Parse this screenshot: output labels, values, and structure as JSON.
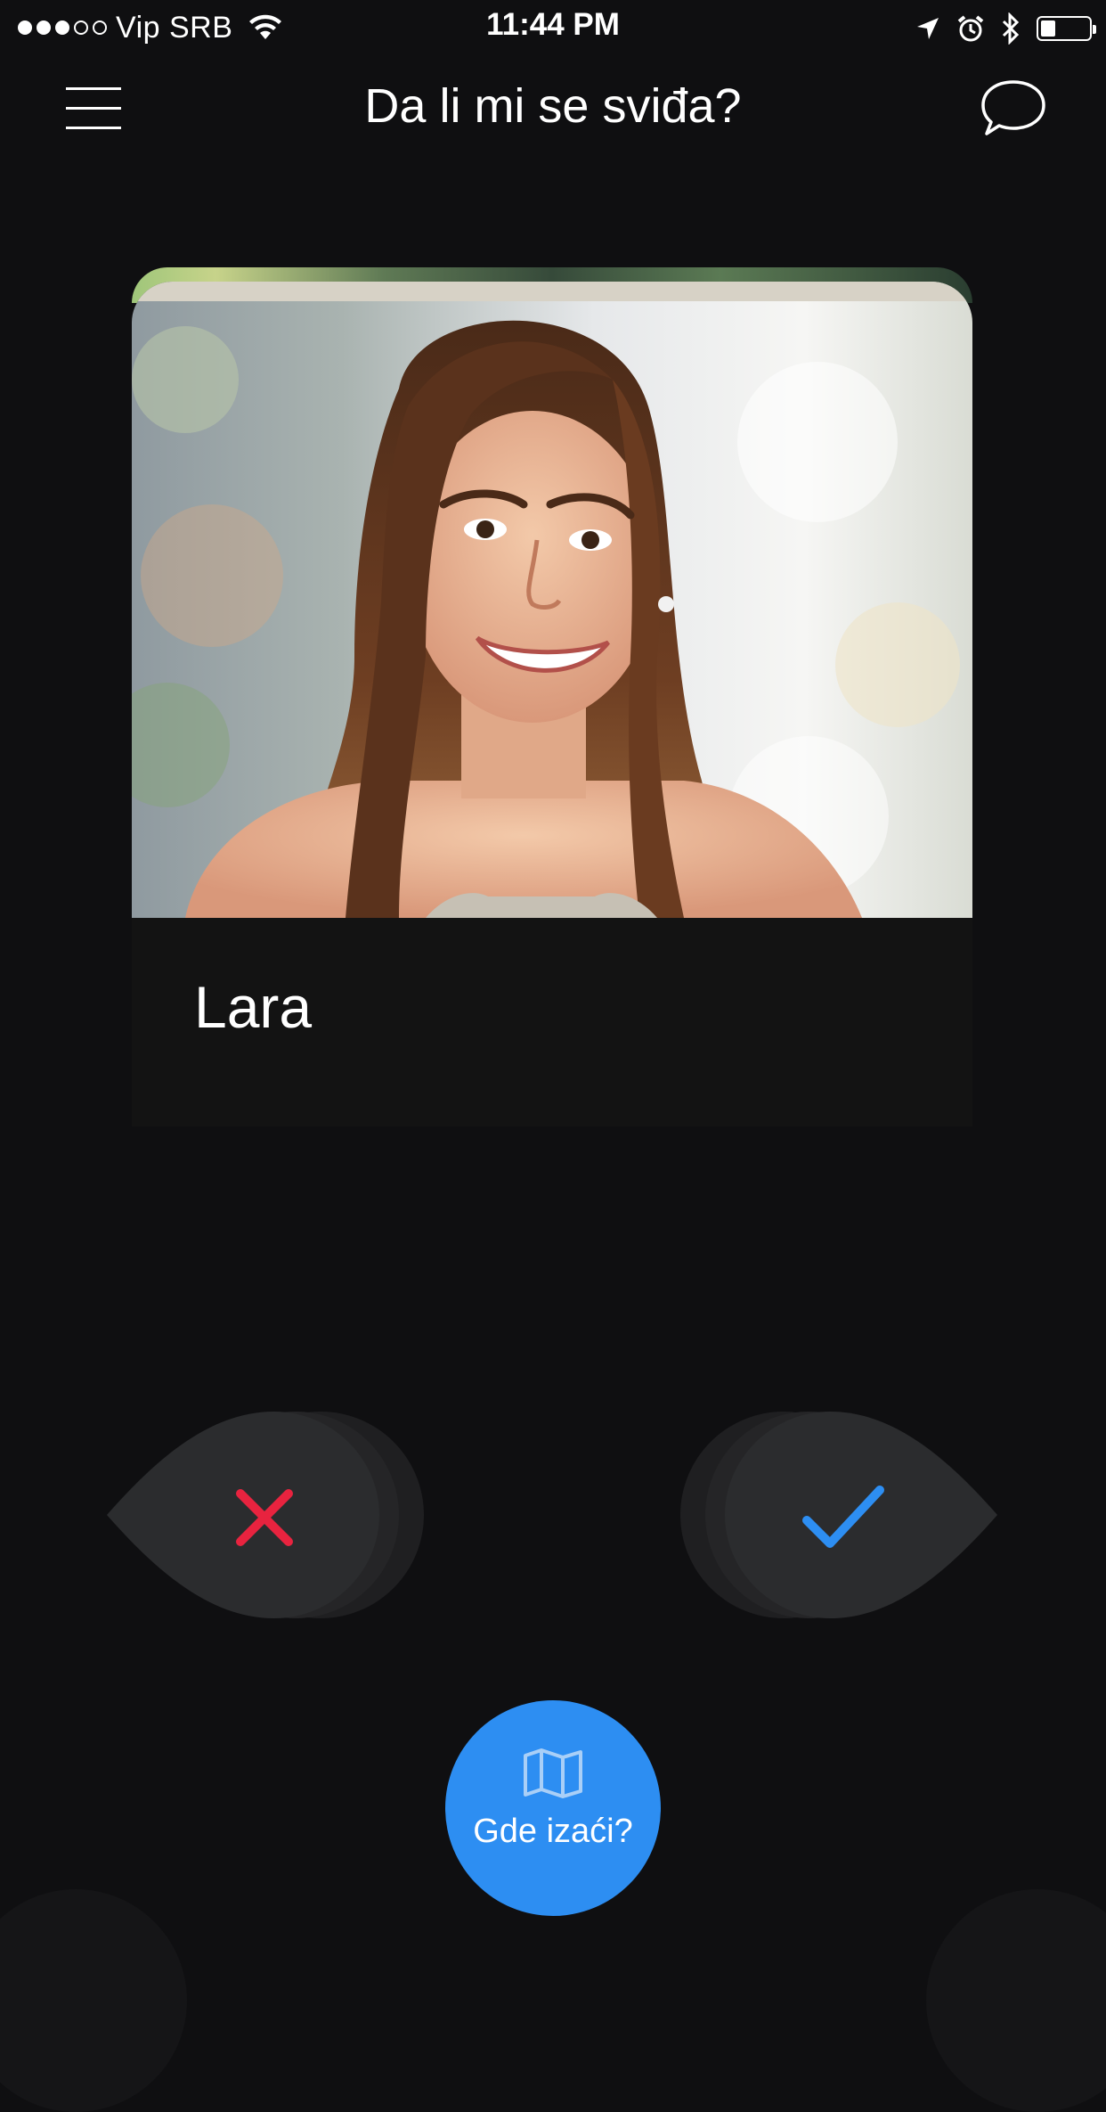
{
  "status_bar": {
    "carrier": "Vip SRB",
    "time": "11:44 PM",
    "signal_strength": 3,
    "signal_max": 5,
    "battery_level": 0.3,
    "icons": [
      "wifi-icon",
      "location-arrow-icon",
      "alarm-icon",
      "bluetooth-icon",
      "battery-icon"
    ]
  },
  "navbar": {
    "title": "Da li mi se sviđa?",
    "left_icon": "hamburger-menu-icon",
    "right_icon": "chat-bubble-icon"
  },
  "profile_card": {
    "name": "Lara",
    "photo": "profile-photo"
  },
  "actions": {
    "dislike_icon": "close-icon",
    "like_icon": "checkmark-icon",
    "dislike_color": "#e8233f",
    "like_color": "#2d8ef2",
    "button_color": "#2b2c2e"
  },
  "fab": {
    "label": "Gde izaći?",
    "icon": "map-icon",
    "color": "#2d8ef2"
  }
}
